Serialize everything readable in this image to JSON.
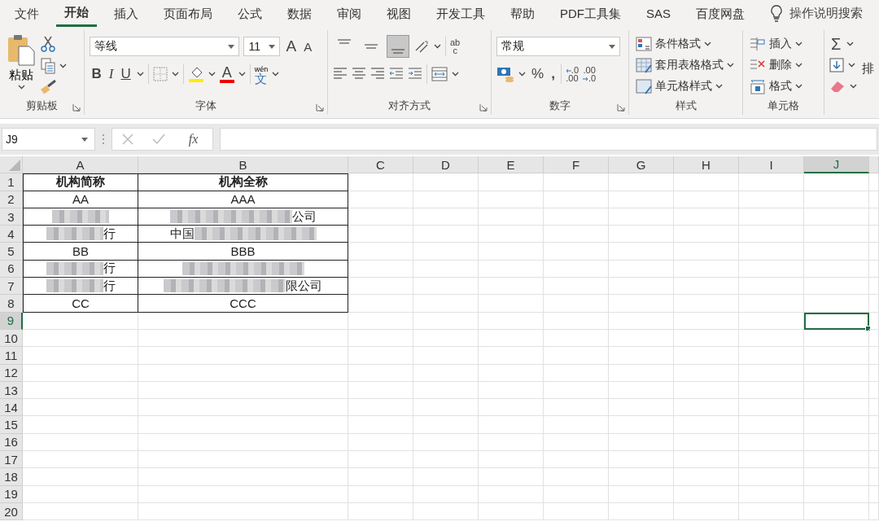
{
  "menu_tabs": [
    {
      "label": "文件",
      "selected": false
    },
    {
      "label": "开始",
      "selected": true
    },
    {
      "label": "插入",
      "selected": false
    },
    {
      "label": "页面布局",
      "selected": false
    },
    {
      "label": "公式",
      "selected": false
    },
    {
      "label": "数据",
      "selected": false
    },
    {
      "label": "审阅",
      "selected": false
    },
    {
      "label": "视图",
      "selected": false
    },
    {
      "label": "开发工具",
      "selected": false
    },
    {
      "label": "帮助",
      "selected": false
    },
    {
      "label": "PDF工具集",
      "selected": false
    },
    {
      "label": "SAS",
      "selected": false
    },
    {
      "label": "百度网盘",
      "selected": false
    }
  ],
  "tell_me": "操作说明搜索",
  "ribbon": {
    "clipboard": {
      "label": "剪贴板",
      "paste": "粘贴"
    },
    "font": {
      "label": "字体",
      "font_name": "等线",
      "font_size": "11",
      "grow": "A",
      "shrink": "A",
      "bold": "B",
      "italic": "I",
      "underline": "U",
      "font_color": "A",
      "phonetic_top": "wén",
      "phonetic": "文"
    },
    "alignment": {
      "label": "对齐方式",
      "vertical": [
        {
          "kind": "top",
          "selected": false
        },
        {
          "kind": "middle",
          "selected": false
        },
        {
          "kind": "bottom",
          "selected": true
        }
      ],
      "wrap_top": "ab",
      "wrap_bottom": "c"
    },
    "number": {
      "label": "数字",
      "format": "常规",
      "percent": "%",
      "comma": ",",
      "increase_decimal": [
        ".0",
        ".00"
      ],
      "decrease_decimal": [
        ".00",
        ".0"
      ]
    },
    "styles": {
      "label": "样式",
      "items": [
        {
          "kind": "conditional",
          "label": "条件格式"
        },
        {
          "kind": "table",
          "label": "套用表格格式"
        },
        {
          "kind": "cell",
          "label": "单元格样式"
        }
      ]
    },
    "cells": {
      "label": "单元格",
      "items": [
        {
          "kind": "insert",
          "label": "插入"
        },
        {
          "kind": "delete",
          "label": "删除"
        },
        {
          "kind": "format",
          "label": "格式"
        }
      ]
    },
    "editing": {
      "sum": "Σ",
      "sort_partial": "排"
    }
  },
  "formula_bar": {
    "name_box": "J9",
    "function_label": "fx"
  },
  "columns": [
    {
      "label": "A",
      "selected": false
    },
    {
      "label": "B",
      "selected": false
    },
    {
      "label": "C",
      "selected": false
    },
    {
      "label": "D",
      "selected": false
    },
    {
      "label": "E",
      "selected": false
    },
    {
      "label": "F",
      "selected": false
    },
    {
      "label": "G",
      "selected": false
    },
    {
      "label": "H",
      "selected": false
    },
    {
      "label": "I",
      "selected": false
    },
    {
      "label": "J",
      "selected": true
    }
  ],
  "rows": [
    {
      "header": "1",
      "selected": false,
      "kind": "header",
      "cells": [
        {
          "text": "机构简称"
        },
        {
          "text": "机构全称"
        }
      ]
    },
    {
      "header": "2",
      "selected": false,
      "kind": "data",
      "cells": [
        {
          "text": "AA"
        },
        {
          "text": "AAA"
        }
      ]
    },
    {
      "header": "3",
      "selected": false,
      "kind": "data",
      "cells": [
        {
          "redacted": true
        },
        {
          "redacted": true,
          "suffix": "公司"
        }
      ]
    },
    {
      "header": "4",
      "selected": false,
      "kind": "data",
      "cells": [
        {
          "redacted": true,
          "suffix": "行"
        },
        {
          "redacted": true,
          "prefix": "中国"
        }
      ]
    },
    {
      "header": "5",
      "selected": false,
      "kind": "data",
      "cells": [
        {
          "text": "BB"
        },
        {
          "text": "BBB"
        }
      ]
    },
    {
      "header": "6",
      "selected": false,
      "kind": "data",
      "cells": [
        {
          "redacted": true,
          "suffix": "行"
        },
        {
          "redacted": true
        }
      ]
    },
    {
      "header": "7",
      "selected": false,
      "kind": "data",
      "cells": [
        {
          "redacted": true,
          "suffix": "行"
        },
        {
          "redacted": true,
          "suffix": "限公司"
        }
      ]
    },
    {
      "header": "8",
      "selected": false,
      "kind": "data",
      "cells": [
        {
          "text": "CC"
        },
        {
          "text": "CCC"
        }
      ]
    },
    {
      "header": "9",
      "selected": true,
      "kind": "empty"
    },
    {
      "header": "10",
      "selected": false,
      "kind": "empty"
    },
    {
      "header": "11",
      "selected": false,
      "kind": "empty"
    },
    {
      "header": "12",
      "selected": false,
      "kind": "empty"
    },
    {
      "header": "13",
      "selected": false,
      "kind": "empty"
    },
    {
      "header": "14",
      "selected": false,
      "kind": "empty"
    },
    {
      "header": "15",
      "selected": false,
      "kind": "empty"
    },
    {
      "header": "16",
      "selected": false,
      "kind": "empty"
    },
    {
      "header": "17",
      "selected": false,
      "kind": "empty"
    },
    {
      "header": "18",
      "selected": false,
      "kind": "empty"
    },
    {
      "header": "19",
      "selected": false,
      "kind": "empty"
    },
    {
      "header": "20",
      "selected": false,
      "kind": "empty"
    }
  ]
}
